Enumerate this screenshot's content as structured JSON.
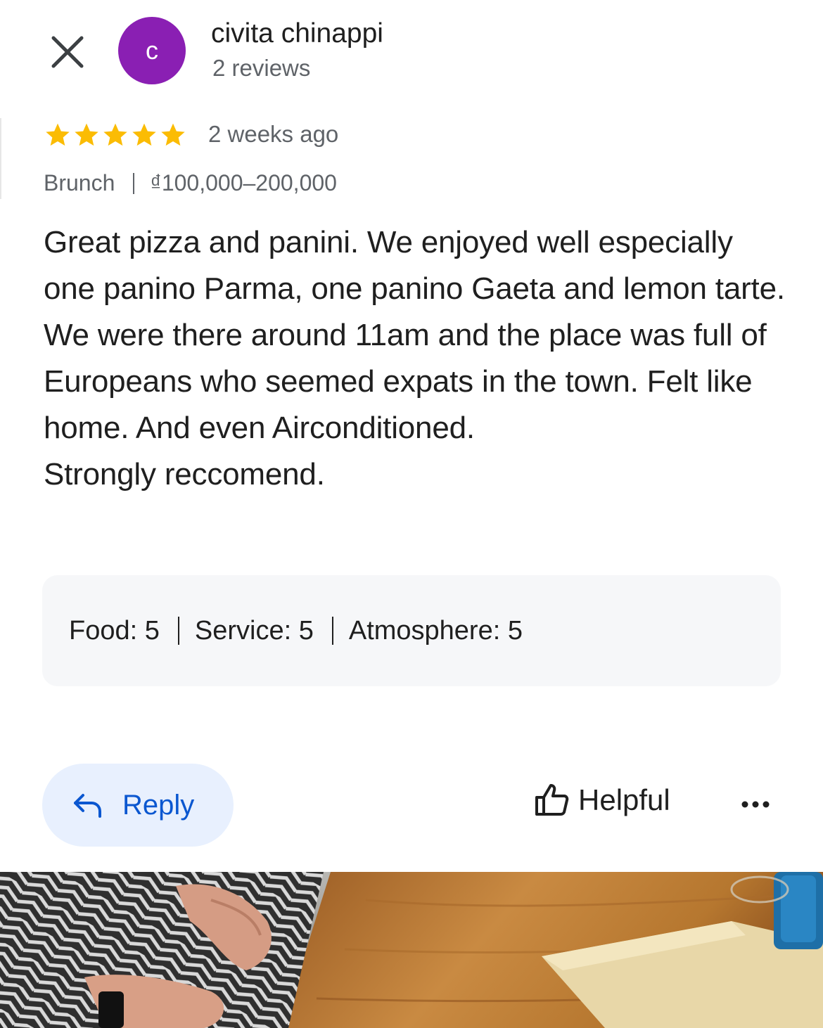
{
  "reviewer": {
    "avatar_letter": "c",
    "name": "civita chinappi",
    "review_count": "2 reviews",
    "avatar_color": "#8a1fb3"
  },
  "review": {
    "rating": 5,
    "time": "2 weeks ago",
    "meal_type": "Brunch",
    "price_range": "₫100,000–200,000",
    "text": "Great pizza and panini. We enjoyed well especially one panino Parma, one panino Gaeta and lemon tarte. We were there around 11am and the place was full of Europeans who seemed expats in the town. Felt like home. And even Airconditioned.\nStrongly reccomend."
  },
  "ratings": [
    {
      "label": "Food: ",
      "value": "5"
    },
    {
      "label": "Service: ",
      "value": "5"
    },
    {
      "label": "Atmosphere: ",
      "value": "5"
    }
  ],
  "actions": {
    "reply_label": "Reply",
    "helpful_label": "Helpful"
  },
  "icons": {
    "close": "close-icon",
    "star": "star-icon",
    "reply": "reply-arrow-icon",
    "helpful": "thumbs-up-icon",
    "more": "more-horizontal-icon"
  },
  "colors": {
    "star": "#fbbc04",
    "reply_text": "#0b57d0",
    "reply_bg": "#e8f0fe",
    "ratings_bg": "#f6f7f9"
  }
}
